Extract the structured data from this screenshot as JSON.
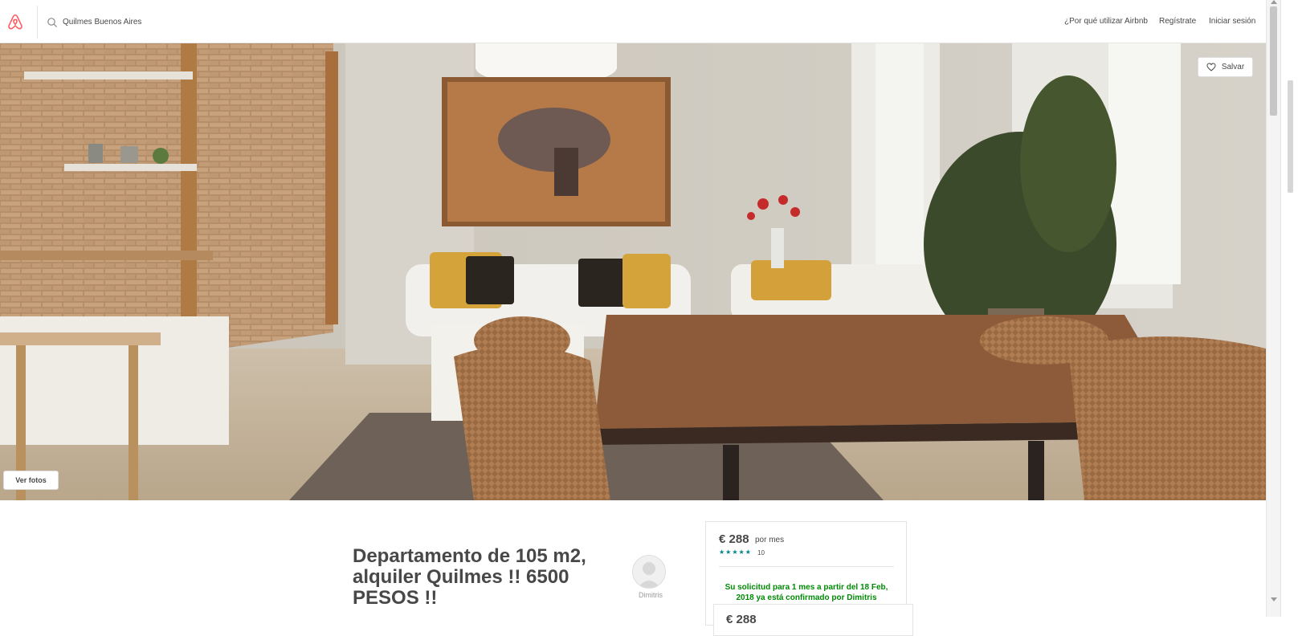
{
  "header": {
    "search": {
      "value": "Quilmes Buenos Aires",
      "placeholder": ""
    },
    "nav": {
      "why": "¿Por qué utilizar Airbnb",
      "register": "Regístrate",
      "login": "Iniciar sesión"
    }
  },
  "hero": {
    "save_label": "Salvar",
    "photos_label": "Ver fotos"
  },
  "listing": {
    "title": "Departamento de 105 m2, alquiler Quilmes !! 6500 PESOS !!",
    "host_name": "Dimitris"
  },
  "booking": {
    "price": "€ 288",
    "price_unit": "por mes",
    "stars": "★★★★★",
    "review_count": "10",
    "rating": 5,
    "confirmation": "Su solicitud para 1 mes a partir del 18 Feb, 2018 ya está confirmado por Dimitris",
    "sticky_price": "€ 288"
  },
  "colors": {
    "brand": "#FF5A5F",
    "text": "#484848",
    "stars": "#008489",
    "confirm": "#008A05"
  },
  "icons": [
    "airbnb-logo-icon",
    "search-icon",
    "heart-icon",
    "user-placeholder-icon"
  ]
}
